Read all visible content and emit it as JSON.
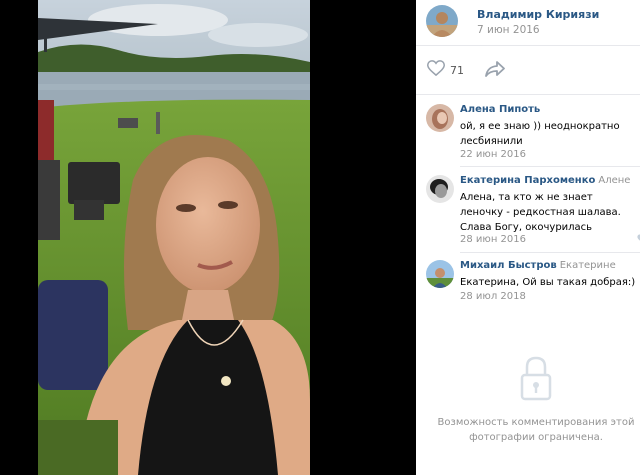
{
  "owner": {
    "name": "Владимир Кириязи",
    "date": "7 июн 2016"
  },
  "actions": {
    "likes_count": "71",
    "like_icon": "heart-outline-icon",
    "share_icon": "share-arrow-icon"
  },
  "comments": [
    {
      "author": "Алена Пипоть",
      "reply_to": "",
      "text": "ой, я ее знаю )) неоднократно лесбиянили",
      "date": "22 июн 2016"
    },
    {
      "author": "Екатерина Пархоменко",
      "reply_to": "Алене",
      "text": "Алена, та кто ж не знает леночку - редкостная шалава. Слава Богу, окочурилась",
      "date": "28 июн 2016"
    },
    {
      "author": "Михаил Быстров",
      "reply_to": "Екатерине",
      "text": "Екатерина, Ой вы такая добрая:)",
      "date": "28 июл 2018"
    }
  ],
  "commenting_closed": {
    "icon": "lock-icon",
    "text": "Возможность комментирования этой фотографии ограничена."
  },
  "colors": {
    "link": "#2a5885",
    "muted": "#939393",
    "icon": "#99a2ad",
    "separator": "#e7e8ec",
    "viewer_background": "#000000"
  }
}
